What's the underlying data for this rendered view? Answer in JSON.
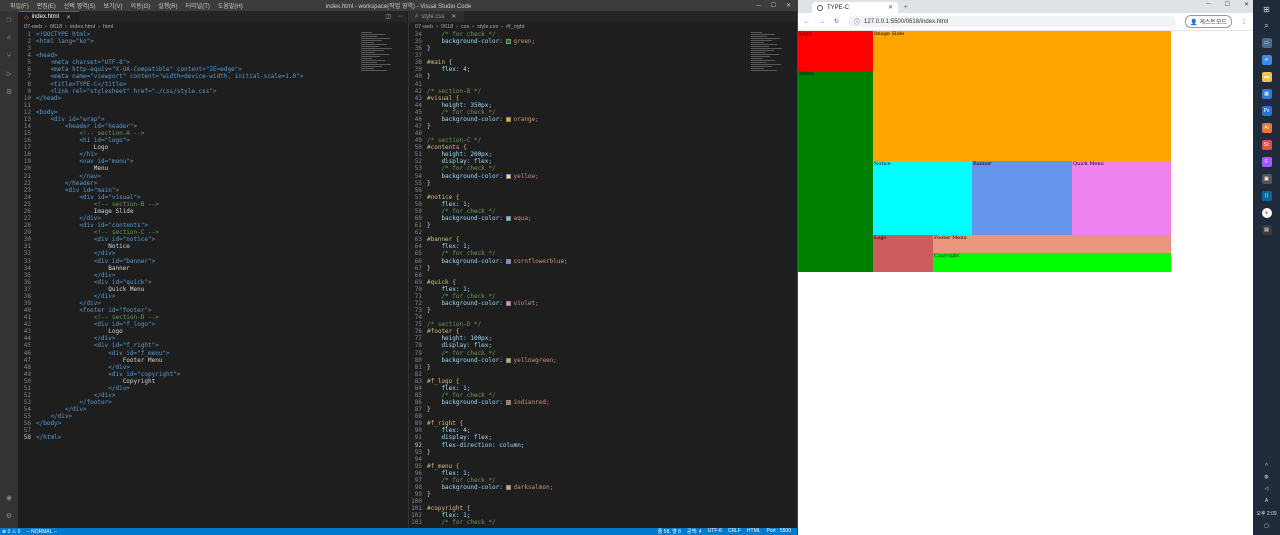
{
  "vscode": {
    "menu": [
      "파일(F)",
      "편집(E)",
      "선택 영역(S)",
      "보기(V)",
      "이동(G)",
      "실행(R)",
      "터미널(T)",
      "도움말(H)"
    ],
    "window_title": "index.html - workspace(작업 영역) - Visual Studio Code",
    "left_tab": "index.html",
    "left_breadcrumb": [
      "07-web",
      "0618",
      "index.html",
      "html"
    ],
    "right_tab": "style.css",
    "right_breadcrumb": [
      "07-web",
      "0618",
      "css",
      "style.css",
      "#f_right"
    ],
    "status_left": [
      "⊗ 0 ⚠ 0",
      "-- NORMAL --"
    ],
    "status_right": [
      "줄 58, 열 8",
      "공백: 4",
      "UTF-8",
      "CRLF",
      "HTML",
      "Port : 5500"
    ]
  },
  "html_lines": [
    {
      "n": "1",
      "t": "<!DOCTYPE html>",
      "k": "tag"
    },
    {
      "n": "2",
      "t": "<html lang=\"ko\">",
      "k": "tag"
    },
    {
      "n": "3",
      "t": "",
      "k": "txt"
    },
    {
      "n": "4",
      "t": "<head>",
      "k": "tag"
    },
    {
      "n": "5",
      "t": "    <meta charset=\"UTF-8\">",
      "k": "tag"
    },
    {
      "n": "6",
      "t": "    <meta http-equiv=\"X-UA-Compatible\" content=\"IE=edge\">",
      "k": "tag"
    },
    {
      "n": "7",
      "t": "    <meta name=\"viewport\" content=\"width=device-width, initial-scale=1.0\">",
      "k": "tag"
    },
    {
      "n": "8",
      "t": "    <title>TYPE-C</title>",
      "k": "tag"
    },
    {
      "n": "9",
      "t": "    <link rel=\"stylesheet\" href=\"./css/style.css\">",
      "k": "tag"
    },
    {
      "n": "10",
      "t": "</head>",
      "k": "tag"
    },
    {
      "n": "11",
      "t": "",
      "k": "txt"
    },
    {
      "n": "12",
      "t": "<body>",
      "k": "tag"
    },
    {
      "n": "13",
      "t": "    <div id=\"wrap\">",
      "k": "tag"
    },
    {
      "n": "14",
      "t": "        <header id=\"header\">",
      "k": "tag"
    },
    {
      "n": "15",
      "t": "            <!-- section-A -->",
      "k": "cmt"
    },
    {
      "n": "16",
      "t": "            <h1 id=\"logo\">",
      "k": "tag"
    },
    {
      "n": "17",
      "t": "                Logo",
      "k": "txt"
    },
    {
      "n": "18",
      "t": "            </h1>",
      "k": "tag"
    },
    {
      "n": "19",
      "t": "            <nav id=\"menu\">",
      "k": "tag"
    },
    {
      "n": "20",
      "t": "                Menu",
      "k": "txt"
    },
    {
      "n": "21",
      "t": "            </nav>",
      "k": "tag"
    },
    {
      "n": "22",
      "t": "        </header>",
      "k": "tag"
    },
    {
      "n": "23",
      "t": "        <div id=\"main\">",
      "k": "tag"
    },
    {
      "n": "24",
      "t": "            <div id=\"visual\">",
      "k": "tag"
    },
    {
      "n": "25",
      "t": "                <!-- section-B -->",
      "k": "cmt"
    },
    {
      "n": "26",
      "t": "                Image Slide",
      "k": "txt"
    },
    {
      "n": "27",
      "t": "            </div>",
      "k": "tag"
    },
    {
      "n": "28",
      "t": "            <div id=\"contents\">",
      "k": "tag"
    },
    {
      "n": "29",
      "t": "                <!-- section-C -->",
      "k": "cmt"
    },
    {
      "n": "30",
      "t": "                <div id=\"notice\">",
      "k": "tag"
    },
    {
      "n": "31",
      "t": "                    Notice",
      "k": "txt"
    },
    {
      "n": "32",
      "t": "                </div>",
      "k": "tag"
    },
    {
      "n": "33",
      "t": "                <div id=\"banner\">",
      "k": "tag"
    },
    {
      "n": "34",
      "t": "                    Banner",
      "k": "txt"
    },
    {
      "n": "35",
      "t": "                </div>",
      "k": "tag"
    },
    {
      "n": "36",
      "t": "                <div id=\"quick\">",
      "k": "tag"
    },
    {
      "n": "37",
      "t": "                    Quick Menu",
      "k": "txt"
    },
    {
      "n": "38",
      "t": "                </div>",
      "k": "tag"
    },
    {
      "n": "39",
      "t": "            </div>",
      "k": "tag"
    },
    {
      "n": "40",
      "t": "            <footer id=\"footer\">",
      "k": "tag"
    },
    {
      "n": "41",
      "t": "                <!-- section-D -->",
      "k": "cmt"
    },
    {
      "n": "42",
      "t": "                <div id=\"f_logo\">",
      "k": "tag"
    },
    {
      "n": "43",
      "t": "                    Logo",
      "k": "txt"
    },
    {
      "n": "44",
      "t": "                </div>",
      "k": "tag"
    },
    {
      "n": "45",
      "t": "                <div id=\"f_right\">",
      "k": "tag"
    },
    {
      "n": "46",
      "t": "                    <div id=\"f_menu\">",
      "k": "tag"
    },
    {
      "n": "47",
      "t": "                        Footer Menu",
      "k": "txt"
    },
    {
      "n": "48",
      "t": "                    </div>",
      "k": "tag"
    },
    {
      "n": "49",
      "t": "                    <div id=\"copyright\">",
      "k": "tag"
    },
    {
      "n": "50",
      "t": "                        Copyright",
      "k": "txt"
    },
    {
      "n": "51",
      "t": "                    </div>",
      "k": "tag"
    },
    {
      "n": "52",
      "t": "                </div>",
      "k": "tag"
    },
    {
      "n": "53",
      "t": "            </footer>",
      "k": "tag"
    },
    {
      "n": "54",
      "t": "        </div>",
      "k": "tag"
    },
    {
      "n": "55",
      "t": "    </div>",
      "k": "tag"
    },
    {
      "n": "56",
      "t": "</body>",
      "k": "tag"
    },
    {
      "n": "57",
      "t": "",
      "k": "txt"
    },
    {
      "n": "58",
      "t": "</html>",
      "k": "tag"
    }
  ],
  "css_lines": [
    {
      "n": "34",
      "t": "    /* for check */",
      "k": "cmt"
    },
    {
      "n": "35",
      "t": "    background-color: green;",
      "k": "prop",
      "c": "#008000"
    },
    {
      "n": "36",
      "t": "}",
      "k": "txt"
    },
    {
      "n": "37",
      "t": "",
      "k": "txt"
    },
    {
      "n": "38",
      "t": "#main {",
      "k": "sel"
    },
    {
      "n": "39",
      "t": "    flex: 4;",
      "k": "prop"
    },
    {
      "n": "40",
      "t": "}",
      "k": "txt"
    },
    {
      "n": "41",
      "t": "",
      "k": "txt"
    },
    {
      "n": "42",
      "t": "/* section-B */",
      "k": "cmt"
    },
    {
      "n": "43",
      "t": "#visual {",
      "k": "sel"
    },
    {
      "n": "44",
      "t": "    height: 350px;",
      "k": "prop"
    },
    {
      "n": "45",
      "t": "    /* for check */",
      "k": "cmt"
    },
    {
      "n": "46",
      "t": "    background-color: orange;",
      "k": "prop",
      "c": "#ffa500"
    },
    {
      "n": "47",
      "t": "}",
      "k": "txt"
    },
    {
      "n": "48",
      "t": "",
      "k": "txt"
    },
    {
      "n": "49",
      "t": "/* section-C */",
      "k": "cmt"
    },
    {
      "n": "50",
      "t": "#contents {",
      "k": "sel"
    },
    {
      "n": "51",
      "t": "    height: 200px;",
      "k": "prop"
    },
    {
      "n": "52",
      "t": "    display: flex;",
      "k": "prop"
    },
    {
      "n": "53",
      "t": "    /* for check */",
      "k": "cmt"
    },
    {
      "n": "54",
      "t": "    background-color: yellow;",
      "k": "prop",
      "c": "#ffff00"
    },
    {
      "n": "55",
      "t": "}",
      "k": "txt"
    },
    {
      "n": "56",
      "t": "",
      "k": "txt"
    },
    {
      "n": "57",
      "t": "#notice {",
      "k": "sel"
    },
    {
      "n": "58",
      "t": "    flex: 1;",
      "k": "prop"
    },
    {
      "n": "59",
      "t": "    /* for check */",
      "k": "cmt"
    },
    {
      "n": "60",
      "t": "    background-color: aqua;",
      "k": "prop",
      "c": "#00ffff"
    },
    {
      "n": "61",
      "t": "}",
      "k": "txt"
    },
    {
      "n": "62",
      "t": "",
      "k": "txt"
    },
    {
      "n": "63",
      "t": "#banner {",
      "k": "sel"
    },
    {
      "n": "64",
      "t": "    flex: 1;",
      "k": "prop"
    },
    {
      "n": "65",
      "t": "    /* for check */",
      "k": "cmt"
    },
    {
      "n": "66",
      "t": "    background-color: cornflowerblue;",
      "k": "prop",
      "c": "#6495ed"
    },
    {
      "n": "67",
      "t": "}",
      "k": "txt"
    },
    {
      "n": "68",
      "t": "",
      "k": "txt"
    },
    {
      "n": "69",
      "t": "#quick {",
      "k": "sel"
    },
    {
      "n": "70",
      "t": "    flex: 1;",
      "k": "prop"
    },
    {
      "n": "71",
      "t": "    /* for check */",
      "k": "cmt"
    },
    {
      "n": "72",
      "t": "    background-color: violet;",
      "k": "prop",
      "c": "#ee82ee"
    },
    {
      "n": "73",
      "t": "}",
      "k": "txt"
    },
    {
      "n": "74",
      "t": "",
      "k": "txt"
    },
    {
      "n": "75",
      "t": "/* section-D */",
      "k": "cmt"
    },
    {
      "n": "76",
      "t": "#footer {",
      "k": "sel"
    },
    {
      "n": "77",
      "t": "    height: 100px;",
      "k": "prop"
    },
    {
      "n": "78",
      "t": "    display: flex;",
      "k": "prop"
    },
    {
      "n": "79",
      "t": "    /* for check */",
      "k": "cmt"
    },
    {
      "n": "80",
      "t": "    background-color: yellowgreen;",
      "k": "prop",
      "c": "#9acd32"
    },
    {
      "n": "81",
      "t": "}",
      "k": "txt"
    },
    {
      "n": "82",
      "t": "",
      "k": "txt"
    },
    {
      "n": "83",
      "t": "#f_logo {",
      "k": "sel"
    },
    {
      "n": "84",
      "t": "    flex: 1;",
      "k": "prop"
    },
    {
      "n": "85",
      "t": "    /* for check */",
      "k": "cmt"
    },
    {
      "n": "86",
      "t": "    background-color: indianred;",
      "k": "prop",
      "c": "#cd5c5c"
    },
    {
      "n": "87",
      "t": "}",
      "k": "txt"
    },
    {
      "n": "88",
      "t": "",
      "k": "txt"
    },
    {
      "n": "89",
      "t": "#f_right {",
      "k": "sel"
    },
    {
      "n": "90",
      "t": "    flex: 4;",
      "k": "prop"
    },
    {
      "n": "91",
      "t": "    display: flex;",
      "k": "prop"
    },
    {
      "n": "92",
      "t": "    flex-direction: column;",
      "k": "prop"
    },
    {
      "n": "93",
      "t": "}",
      "k": "txt"
    },
    {
      "n": "94",
      "t": "",
      "k": "txt"
    },
    {
      "n": "95",
      "t": "#f_menu {",
      "k": "sel"
    },
    {
      "n": "96",
      "t": "    flex: 1;",
      "k": "prop"
    },
    {
      "n": "97",
      "t": "    /* for check */",
      "k": "cmt"
    },
    {
      "n": "98",
      "t": "    background-color: darksalmon;",
      "k": "prop",
      "c": "#e9967a"
    },
    {
      "n": "99",
      "t": "}",
      "k": "txt"
    },
    {
      "n": "100",
      "t": "",
      "k": "txt"
    },
    {
      "n": "101",
      "t": "#copyright {",
      "k": "sel"
    },
    {
      "n": "102",
      "t": "    flex: 1;",
      "k": "prop"
    },
    {
      "n": "103",
      "t": "    /* for check */",
      "k": "cmt"
    }
  ],
  "browser": {
    "tab_title": "TYPE-C",
    "url": "127.0.0.1:5500/0618/index.html",
    "guest_label": "게스트모드"
  },
  "preview": {
    "logo": {
      "label": "Logo",
      "color": "#ff0000"
    },
    "menu": {
      "label": "Menu",
      "color": "#008000"
    },
    "visual": {
      "label": "Image Slide",
      "color": "#ffa500"
    },
    "notice": {
      "label": "Notice",
      "color": "#00ffff"
    },
    "banner": {
      "label": "Banner",
      "color": "#6495ed"
    },
    "quick": {
      "label": "Quick Menu",
      "color": "#ee82ee"
    },
    "f_logo": {
      "label": "Logo",
      "color": "#cd5c5c"
    },
    "f_menu": {
      "label": "Footer Menu",
      "color": "#e9967a"
    },
    "copyright": {
      "label": "Copyright",
      "color": "#00ff00"
    }
  },
  "taskbar": {
    "time": "오후 2:09"
  }
}
